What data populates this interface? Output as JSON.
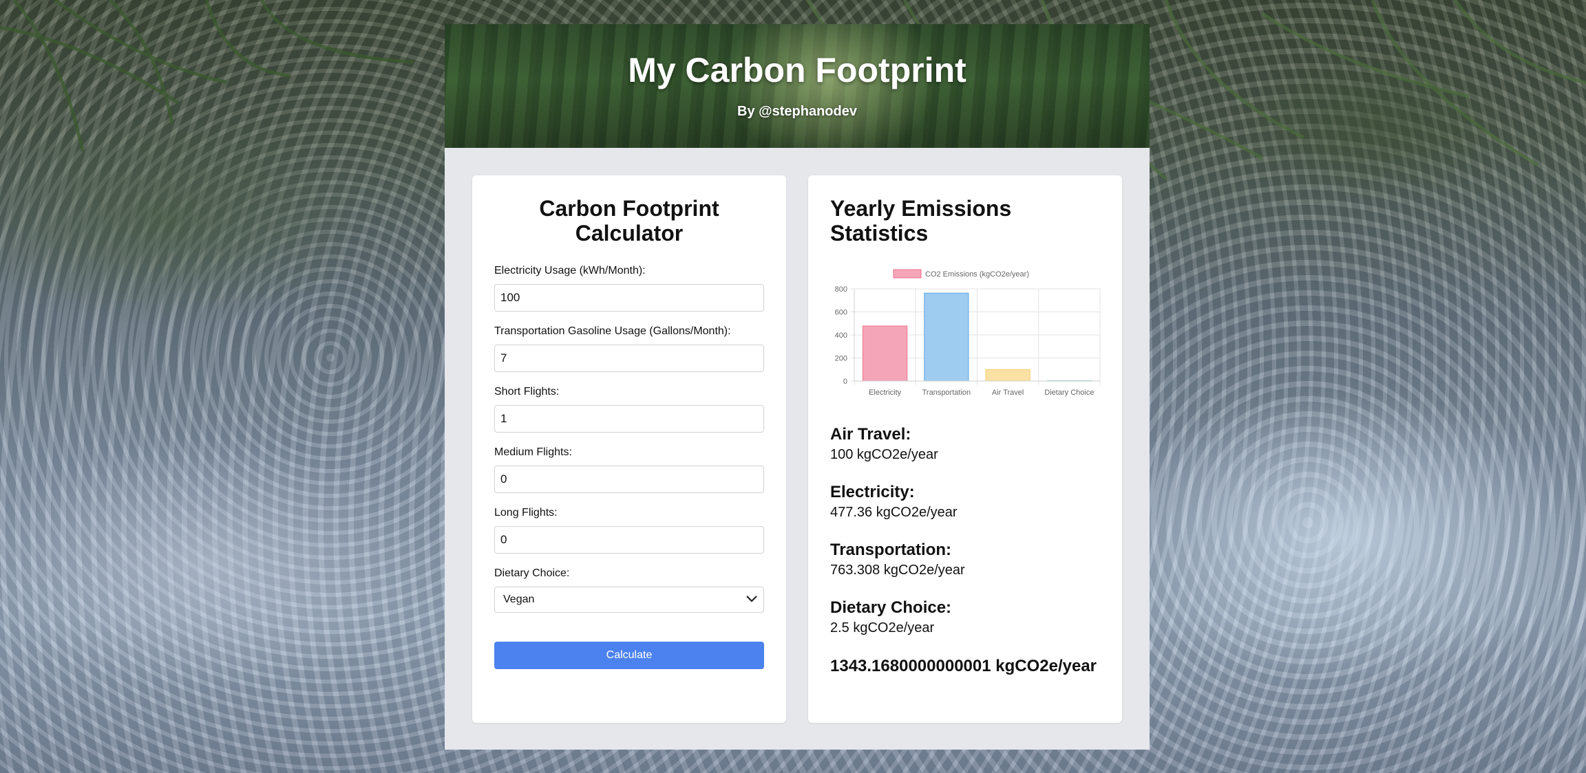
{
  "header": {
    "title": "My Carbon Footprint",
    "byline": "By @stephanodev"
  },
  "calculator": {
    "title": "Carbon Footprint Calculator",
    "fields": [
      {
        "label": "Electricity Usage (kWh/Month):",
        "value": "100"
      },
      {
        "label": "Transportation Gasoline Usage (Gallons/Month):",
        "value": "7"
      },
      {
        "label": "Short Flights:",
        "value": "1"
      },
      {
        "label": "Medium Flights:",
        "value": "0"
      },
      {
        "label": "Long Flights:",
        "value": "0"
      }
    ],
    "diet": {
      "label": "Dietary Choice:",
      "selected": "Vegan",
      "icon": "chevron-down-icon"
    },
    "button_label": "Calculate",
    "button_color": "#4c82ef"
  },
  "stats": {
    "title": "Yearly Emissions Statistics",
    "items": [
      {
        "title": "Air Travel:",
        "value": "100 kgCO2e/year"
      },
      {
        "title": "Electricity:",
        "value": "477.36 kgCO2e/year"
      },
      {
        "title": "Transportation:",
        "value": "763.308 kgCO2e/year"
      },
      {
        "title": "Dietary Choice:",
        "value": "2.5 kgCO2e/year"
      }
    ],
    "total": "1343.1680000000001 kgCO2e/year"
  },
  "chart_data": {
    "type": "bar",
    "categories": [
      "Electricity",
      "Transportation",
      "Air Travel",
      "Dietary Choice"
    ],
    "series": [
      {
        "name": "CO2 Emissions (kgCO2e/year)",
        "values": [
          477.36,
          763.308,
          100,
          2.5
        ]
      }
    ],
    "yticks": [
      0,
      200,
      400,
      600,
      800
    ],
    "ylim": [
      0,
      800
    ],
    "grid": true,
    "legend": "top",
    "colors": [
      "#f4a6b8",
      "#9ecbf0",
      "#fbe1a4",
      "#b6e3e3"
    ],
    "borders": [
      "#ef6f8e",
      "#5ea9e6",
      "#f6cf72",
      "#79cbcb"
    ]
  }
}
